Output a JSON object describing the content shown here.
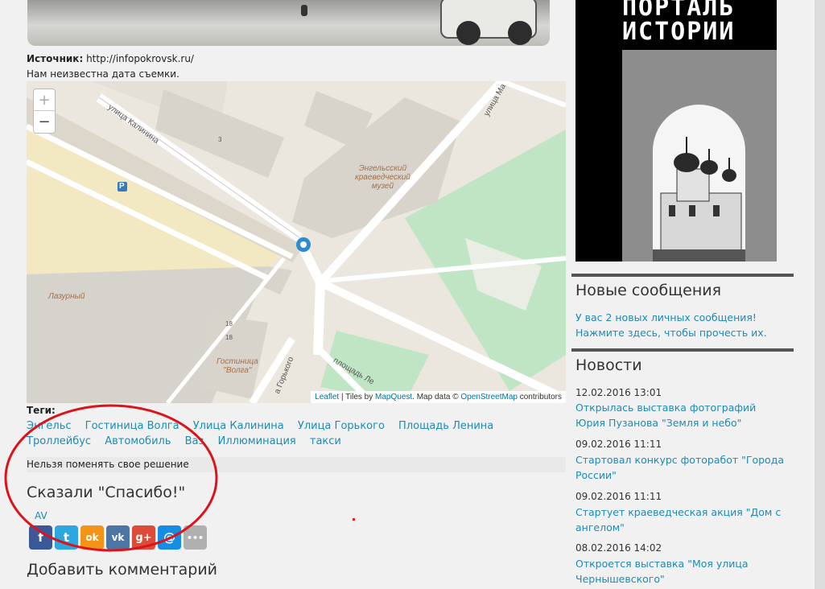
{
  "article": {
    "source_label": "Источник:",
    "source_url": "http://infopokrovsk.ru/",
    "date_note": "Нам неизвестна дата съемки."
  },
  "map": {
    "zoom_in": "+",
    "zoom_out": "−",
    "labels": {
      "street_kalinina": "улица Калинина",
      "street_ma": "улица Ма",
      "museum_line1": "Энгельсский",
      "museum_line2": "краеведческий",
      "museum_line3": "музей",
      "lazurny": "Лазурный",
      "hotel_line1": "Гостиница",
      "hotel_line2": "\"Волга\"",
      "street_gorkogo": "а Горького",
      "square_lenina": "площадь Ле",
      "house_3": "3",
      "house_18a": "18",
      "house_18b": "18",
      "parking": "P"
    },
    "attribution": {
      "leaflet": "Leaflet",
      "tiles_by": " | Tiles by ",
      "mapquest": "MapQuest",
      "map_data": ". Map data © ",
      "osm": "OpenStreetMap",
      "contributors": " contributors"
    }
  },
  "tags": {
    "label": "Теги:",
    "row1": [
      "Энгельс",
      "Гостиница Волга",
      "Улица Калинина",
      "Улица Горького",
      "Площадь Ленина"
    ],
    "row2": [
      "Троллейбус",
      "Автомобиль",
      "Ваз",
      "Иллюминация",
      "такси"
    ]
  },
  "decision_text": "Нельзя поменять свое решение",
  "thanks": {
    "title": "Сказали \"Спасибо!\"",
    "user": "AV"
  },
  "share": [
    {
      "icon": "facebook-icon",
      "glyph": "f",
      "color": "#3b5998"
    },
    {
      "icon": "twitter-icon",
      "glyph": "t",
      "color": "#2ca7e0"
    },
    {
      "icon": "odnoklassniki-icon",
      "glyph": "ok",
      "color": "#f39419"
    },
    {
      "icon": "vkontakte-icon",
      "glyph": "vk",
      "color": "#4c75a3"
    },
    {
      "icon": "googleplus-icon",
      "glyph": "g+",
      "color": "#dd4b39"
    },
    {
      "icon": "mailru-icon",
      "glyph": "@",
      "color": "#168de2"
    },
    {
      "icon": "more-icon",
      "glyph": "•••",
      "color": "#b0b0b0"
    }
  ],
  "add_comment": "Добавить комментарий",
  "poster": {
    "line1": "ПОРТАЛЬ",
    "line2": "ИСТОРИИ"
  },
  "new_messages": {
    "title": "Новые сообщения",
    "line1": "У вас 2 новых личных сообщения!",
    "line2": "Нажмите здесь, чтобы прочесть их."
  },
  "news": {
    "title": "Новости",
    "items": [
      {
        "date": "12.02.2016 13:01",
        "title": "Открылась выставка фотографий Юрия Пузанова \"Земля и небо\""
      },
      {
        "date": "09.02.2016 11:11",
        "title": "Стартовал конкурс фоторабот \"Города России\""
      },
      {
        "date": "09.02.2016 11:11",
        "title": "Стартует краеведческая акция \"Дом с ангелом\""
      },
      {
        "date": "08.02.2016 14:02",
        "title": "Откроется выставка \"Моя улица Чернышевского\""
      }
    ]
  },
  "colors": {
    "link": "#1c8bb5",
    "annotation_red": "#d9141b"
  }
}
